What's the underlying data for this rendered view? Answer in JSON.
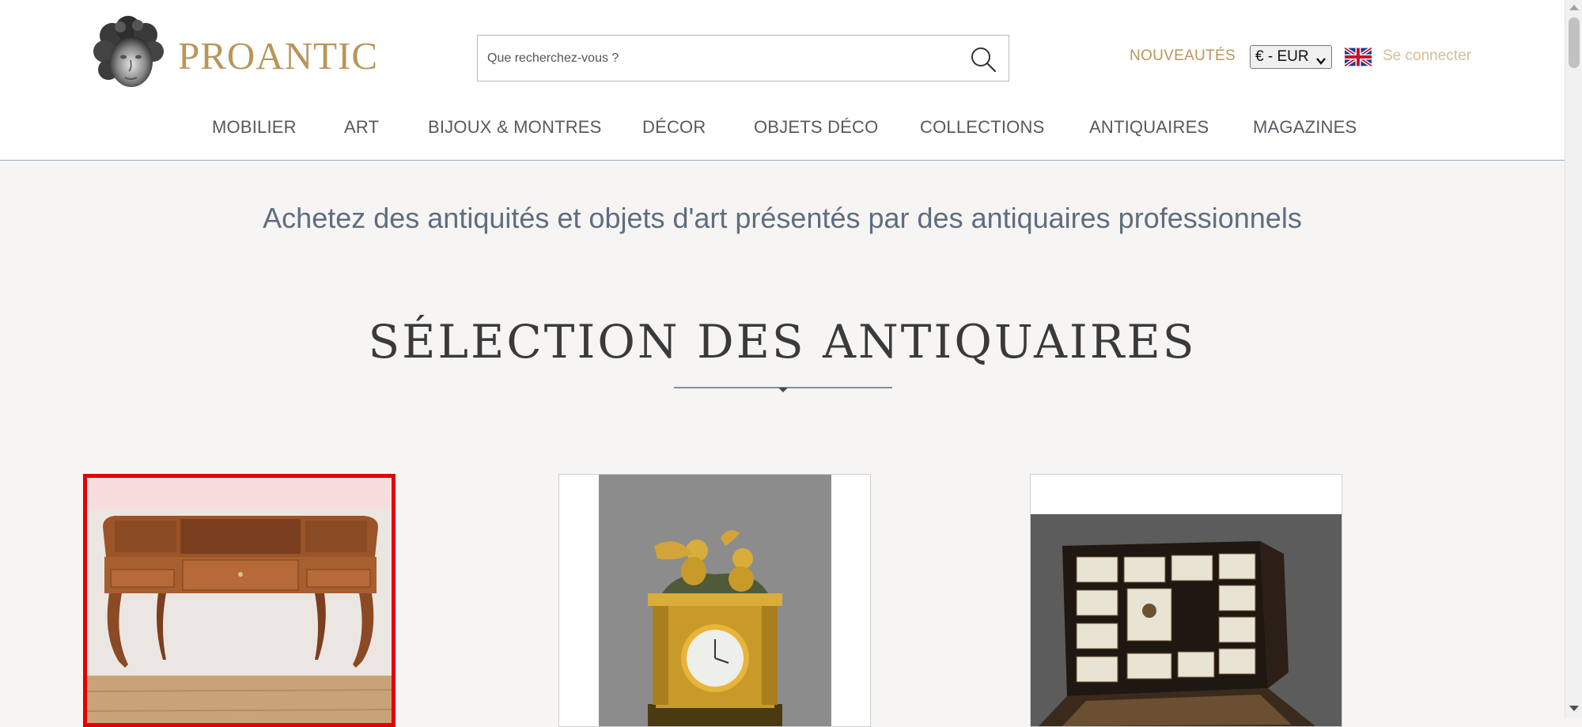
{
  "header": {
    "logo_text": "PROANTIC",
    "logo_icon": "cherub-head-icon",
    "search": {
      "placeholder": "Que recherchez-vous ?",
      "icon": "search-icon"
    },
    "new_link": "NOUVEAUTÉS",
    "currency": {
      "selected": "€ - EUR"
    },
    "language_flag": "uk-flag-icon",
    "login": "Se connecter"
  },
  "nav": {
    "items": [
      {
        "label": "MOBILIER"
      },
      {
        "label": "ART"
      },
      {
        "label": "BIJOUX & MONTRES"
      },
      {
        "label": "DÉCOR"
      },
      {
        "label": "OBJETS DÉCO"
      },
      {
        "label": "COLLECTIONS"
      },
      {
        "label": "ANTIQUAIRES"
      },
      {
        "label": "MAGAZINES"
      }
    ]
  },
  "main": {
    "tagline": "Achetez des antiquités et objets d'art présentés par des antiquaires professionnels",
    "section_title": "SÉLECTION DES ANTIQUAIRES",
    "cards": [
      {
        "subject": "louis-xv-dressing-table",
        "selected": true
      },
      {
        "subject": "gilt-bronze-mantel-clock",
        "selected": false
      },
      {
        "subject": "ebony-ivory-cabinet",
        "selected": false
      }
    ]
  },
  "colors": {
    "brand_gold": "#b8965a",
    "nav_text": "#555a60",
    "tagline": "#5f6d80",
    "selection_border": "#e40000",
    "page_bg": "#f6f5f3"
  }
}
